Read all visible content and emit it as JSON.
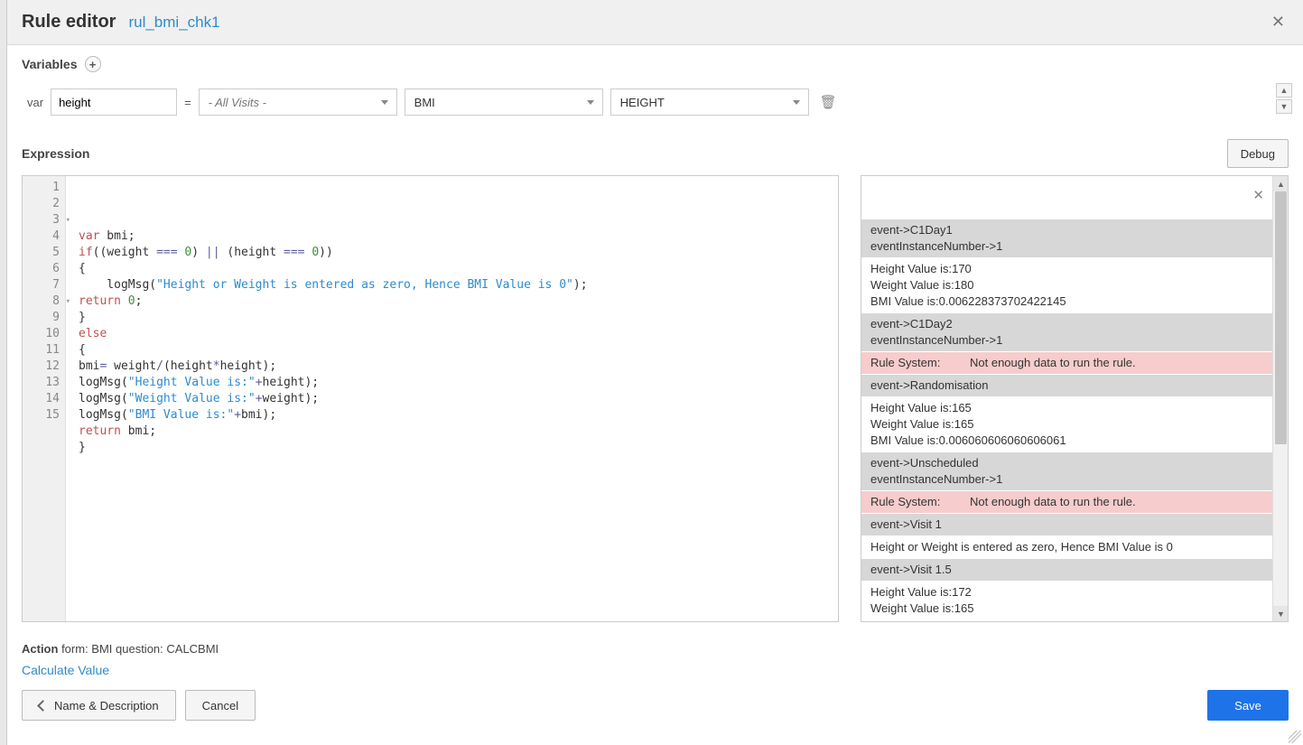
{
  "header": {
    "title": "Rule editor",
    "rule_name": "rul_bmi_chk1"
  },
  "variables": {
    "section": "Variables",
    "var_label": "var",
    "name": "height",
    "eq": "=",
    "visits": "- All Visits -",
    "form": "BMI",
    "field": "HEIGHT"
  },
  "expression": {
    "label": "Expression",
    "debug": "Debug"
  },
  "code_lines": [
    {
      "n": "1",
      "h": "<span class='kw'>var</span> bmi;"
    },
    {
      "n": "2",
      "h": "<span class='kw'>if</span>((weight <span class='op'>===</span> <span class='num'>0</span>) <span class='op'>||</span> (height <span class='op'>===</span> <span class='num'>0</span>))"
    },
    {
      "n": "3",
      "h": "{",
      "fold": true
    },
    {
      "n": "4",
      "h": "    logMsg(<span class='str'>\"Height or Weight is entered as zero, Hence BMI Value is 0\"</span>);"
    },
    {
      "n": "5",
      "h": "<span class='kw'>return</span> <span class='num'>0</span>;"
    },
    {
      "n": "6",
      "h": "}"
    },
    {
      "n": "7",
      "h": "<span class='kw'>else</span>"
    },
    {
      "n": "8",
      "h": "{",
      "fold": true
    },
    {
      "n": "9",
      "h": "bmi<span class='op'>=</span> weight<span class='op'>/</span>(height<span class='op'>*</span>height);"
    },
    {
      "n": "10",
      "h": "logMsg(<span class='str'>\"Height Value is:\"</span><span class='op'>+</span>height);"
    },
    {
      "n": "11",
      "h": "logMsg(<span class='str'>\"Weight Value is:\"</span><span class='op'>+</span>weight);"
    },
    {
      "n": "12",
      "h": "logMsg(<span class='str'>\"BMI Value is:\"</span><span class='op'>+</span>bmi);"
    },
    {
      "n": "13",
      "h": "<span class='kw'>return</span> bmi;"
    },
    {
      "n": "14",
      "h": "}"
    },
    {
      "n": "15",
      "h": ""
    }
  ],
  "debug_rows": [
    {
      "cls": "dbg-spacer",
      "lines": []
    },
    {
      "cls": "dbg-grey",
      "lines": [
        "event->C1Day1",
        "eventInstanceNumber->1"
      ]
    },
    {
      "cls": "dbg-white",
      "lines": [
        "Height Value is:170",
        "Weight Value is:180",
        "BMI Value is:0.006228373702422145"
      ]
    },
    {
      "cls": "dbg-grey",
      "lines": [
        "event->C1Day2",
        "eventInstanceNumber->1"
      ]
    },
    {
      "cls": "dbg-pink dbg-sys",
      "l": "Rule System:",
      "r": "Not enough data to run the rule."
    },
    {
      "cls": "dbg-grey",
      "lines": [
        "event->Randomisation"
      ]
    },
    {
      "cls": "dbg-white",
      "lines": [
        "Height Value is:165",
        "Weight Value is:165",
        "BMI Value is:0.006060606060606061"
      ]
    },
    {
      "cls": "dbg-grey",
      "lines": [
        "event->Unscheduled",
        "eventInstanceNumber->1"
      ]
    },
    {
      "cls": "dbg-pink dbg-sys",
      "l": "Rule System:",
      "r": "Not enough data to run the rule."
    },
    {
      "cls": "dbg-grey",
      "lines": [
        "event->Visit 1"
      ]
    },
    {
      "cls": "dbg-white",
      "lines": [
        "Height or Weight is entered as zero, Hence BMI Value is 0"
      ]
    },
    {
      "cls": "dbg-grey",
      "lines": [
        "event->Visit 1.5"
      ]
    },
    {
      "cls": "dbg-white",
      "lines": [
        "Height Value is:172",
        "Weight Value is:165"
      ]
    }
  ],
  "footer": {
    "action_label": "Action ",
    "action_value": "form: BMI question: CALCBMI",
    "calc": "Calculate Value",
    "back": "Name & Description",
    "cancel": "Cancel",
    "save": "Save"
  }
}
